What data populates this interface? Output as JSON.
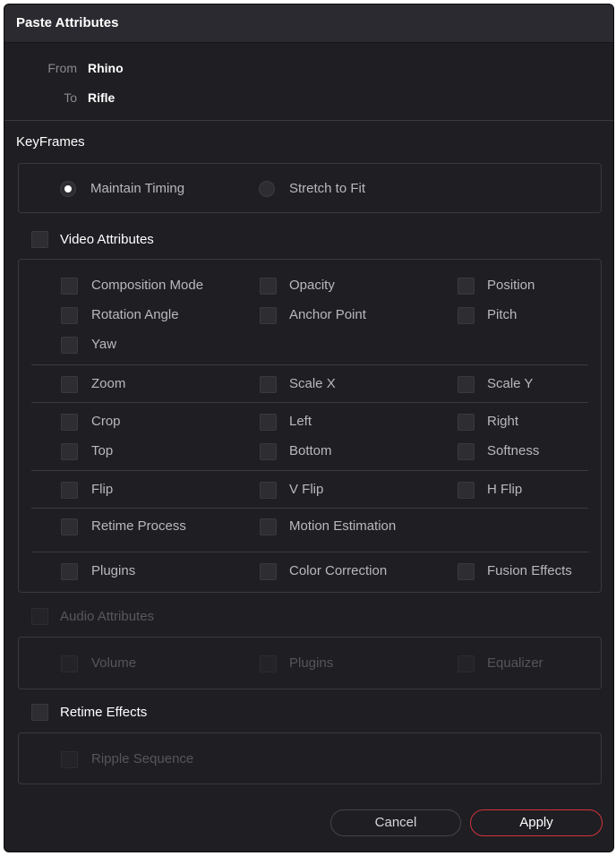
{
  "dialog": {
    "title": "Paste Attributes",
    "from_label": "From",
    "from_value": "Rhino",
    "to_label": "To",
    "to_value": "Rifle"
  },
  "keyframes": {
    "label": "KeyFrames",
    "options": [
      "Maintain Timing",
      "Stretch to Fit"
    ],
    "selected": "Maintain Timing"
  },
  "video": {
    "label": "Video Attributes",
    "checked": false,
    "items": {
      "composition_mode": "Composition Mode",
      "opacity": "Opacity",
      "position": "Position",
      "rotation_angle": "Rotation Angle",
      "anchor_point": "Anchor Point",
      "pitch": "Pitch",
      "yaw": "Yaw",
      "zoom": "Zoom",
      "scale_x": "Scale X",
      "scale_y": "Scale Y",
      "crop": "Crop",
      "left": "Left",
      "right": "Right",
      "top": "Top",
      "bottom": "Bottom",
      "softness": "Softness",
      "flip": "Flip",
      "v_flip": "V Flip",
      "h_flip": "H Flip",
      "retime_process": "Retime Process",
      "motion_estimation": "Motion Estimation",
      "plugins": "Plugins",
      "color_correction": "Color Correction",
      "fusion_effects": "Fusion Effects"
    }
  },
  "audio": {
    "label": "Audio Attributes",
    "enabled": false,
    "items": {
      "volume": "Volume",
      "plugins": "Plugins",
      "equalizer": "Equalizer"
    }
  },
  "retime": {
    "label": "Retime Effects",
    "checked": false,
    "items": {
      "ripple_sequence": "Ripple Sequence"
    }
  },
  "buttons": {
    "cancel": "Cancel",
    "apply": "Apply"
  },
  "colors": {
    "background": "#1f1e23",
    "titlebar": "#2b2a30",
    "apply_border": "#d0343b"
  }
}
